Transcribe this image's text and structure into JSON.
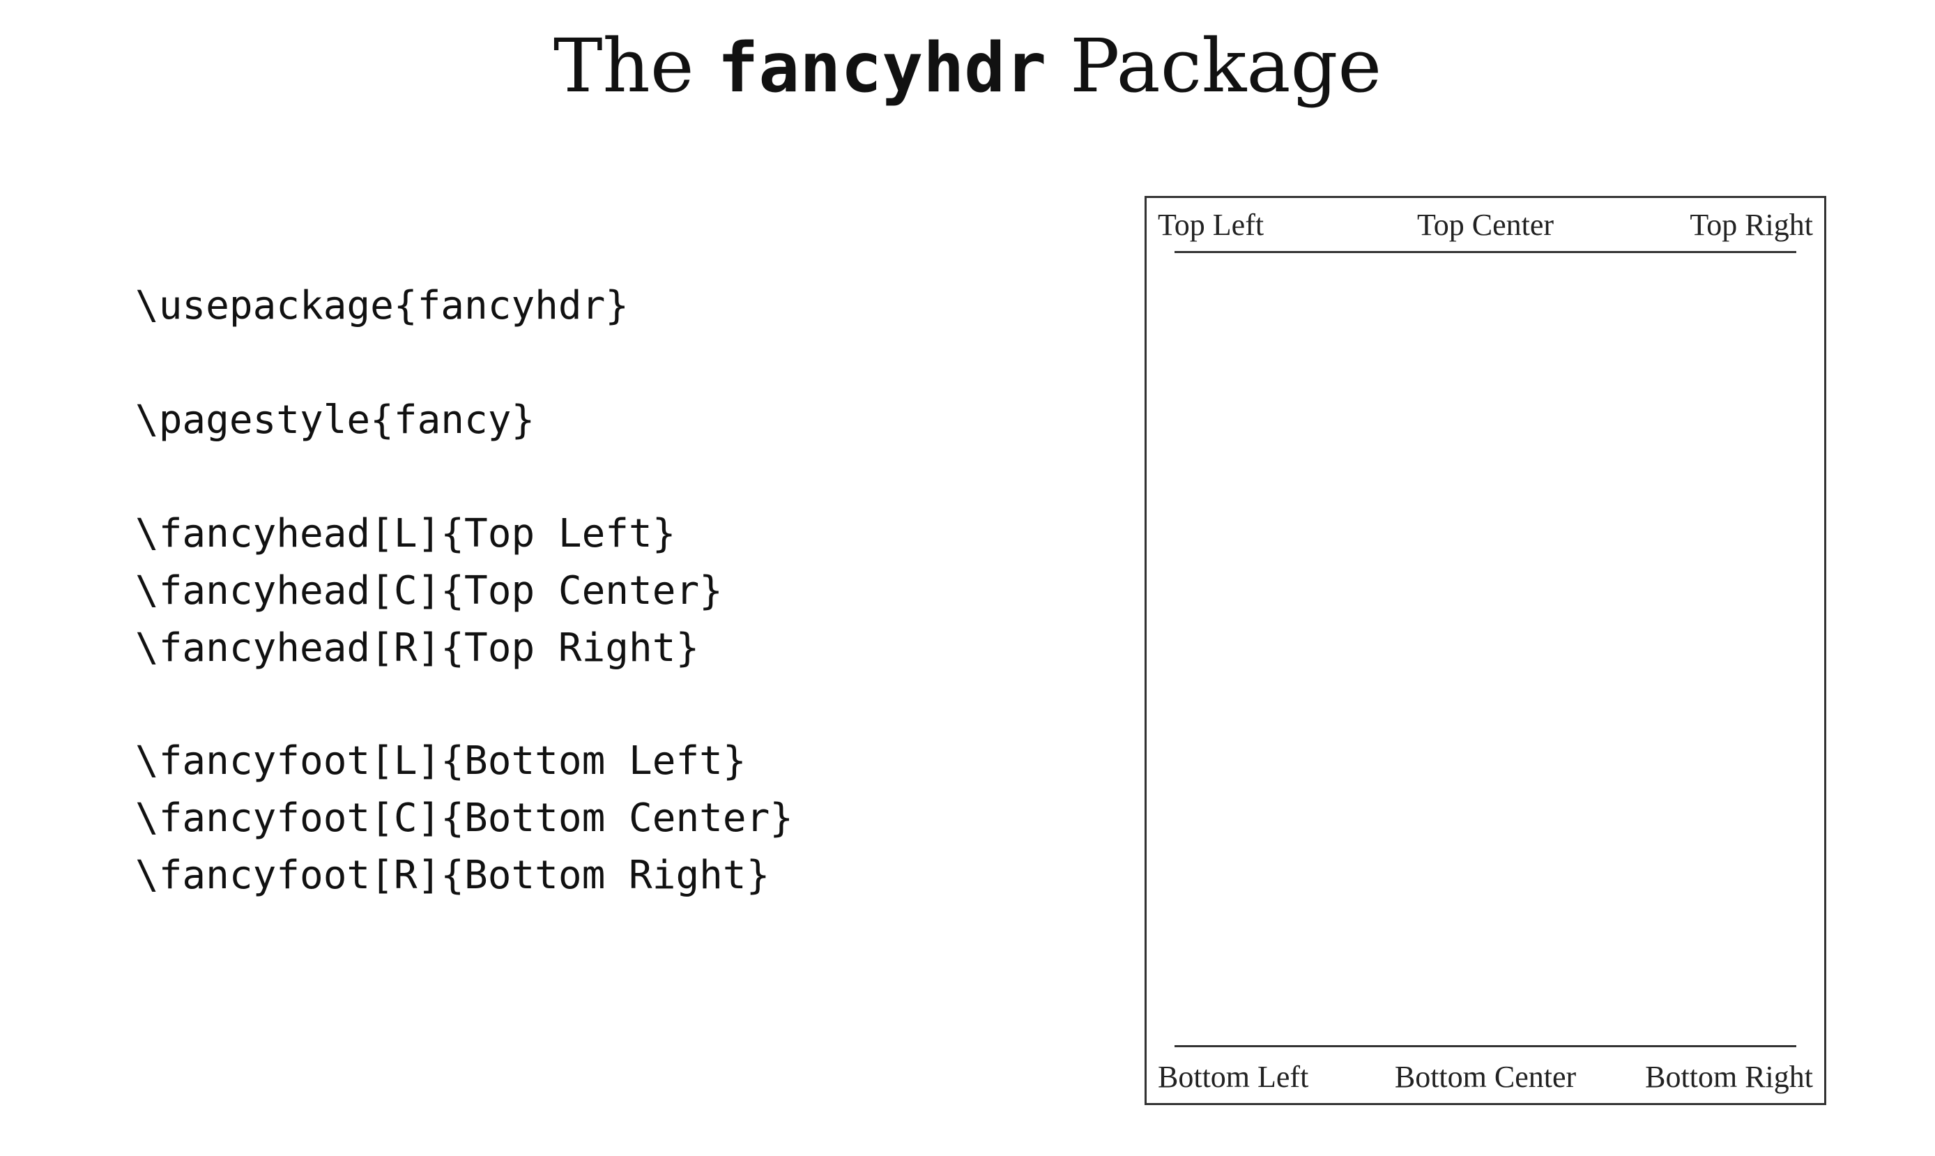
{
  "title": {
    "prefix": "The",
    "package": "fancyhdr",
    "suffix": "Package"
  },
  "code_lines": [
    "\\usepackage{fancyhdr}",
    "\\pagestyle{fancy}",
    "\\fancyhead[L]{Top Left}",
    "\\fancyhead[C]{Top Center}",
    "\\fancyhead[R]{Top Right}",
    "\\fancyfoot[L]{Bottom Left}",
    "\\fancyfoot[C]{Bottom Center}",
    "\\fancyfoot[R]{Bottom Right}"
  ],
  "preview": {
    "header": {
      "left": "Top Left",
      "center": "Top Center",
      "right": "Top Right"
    },
    "footer": {
      "left": "Bottom Left",
      "center": "Bottom Center",
      "right": "Bottom Right"
    }
  }
}
